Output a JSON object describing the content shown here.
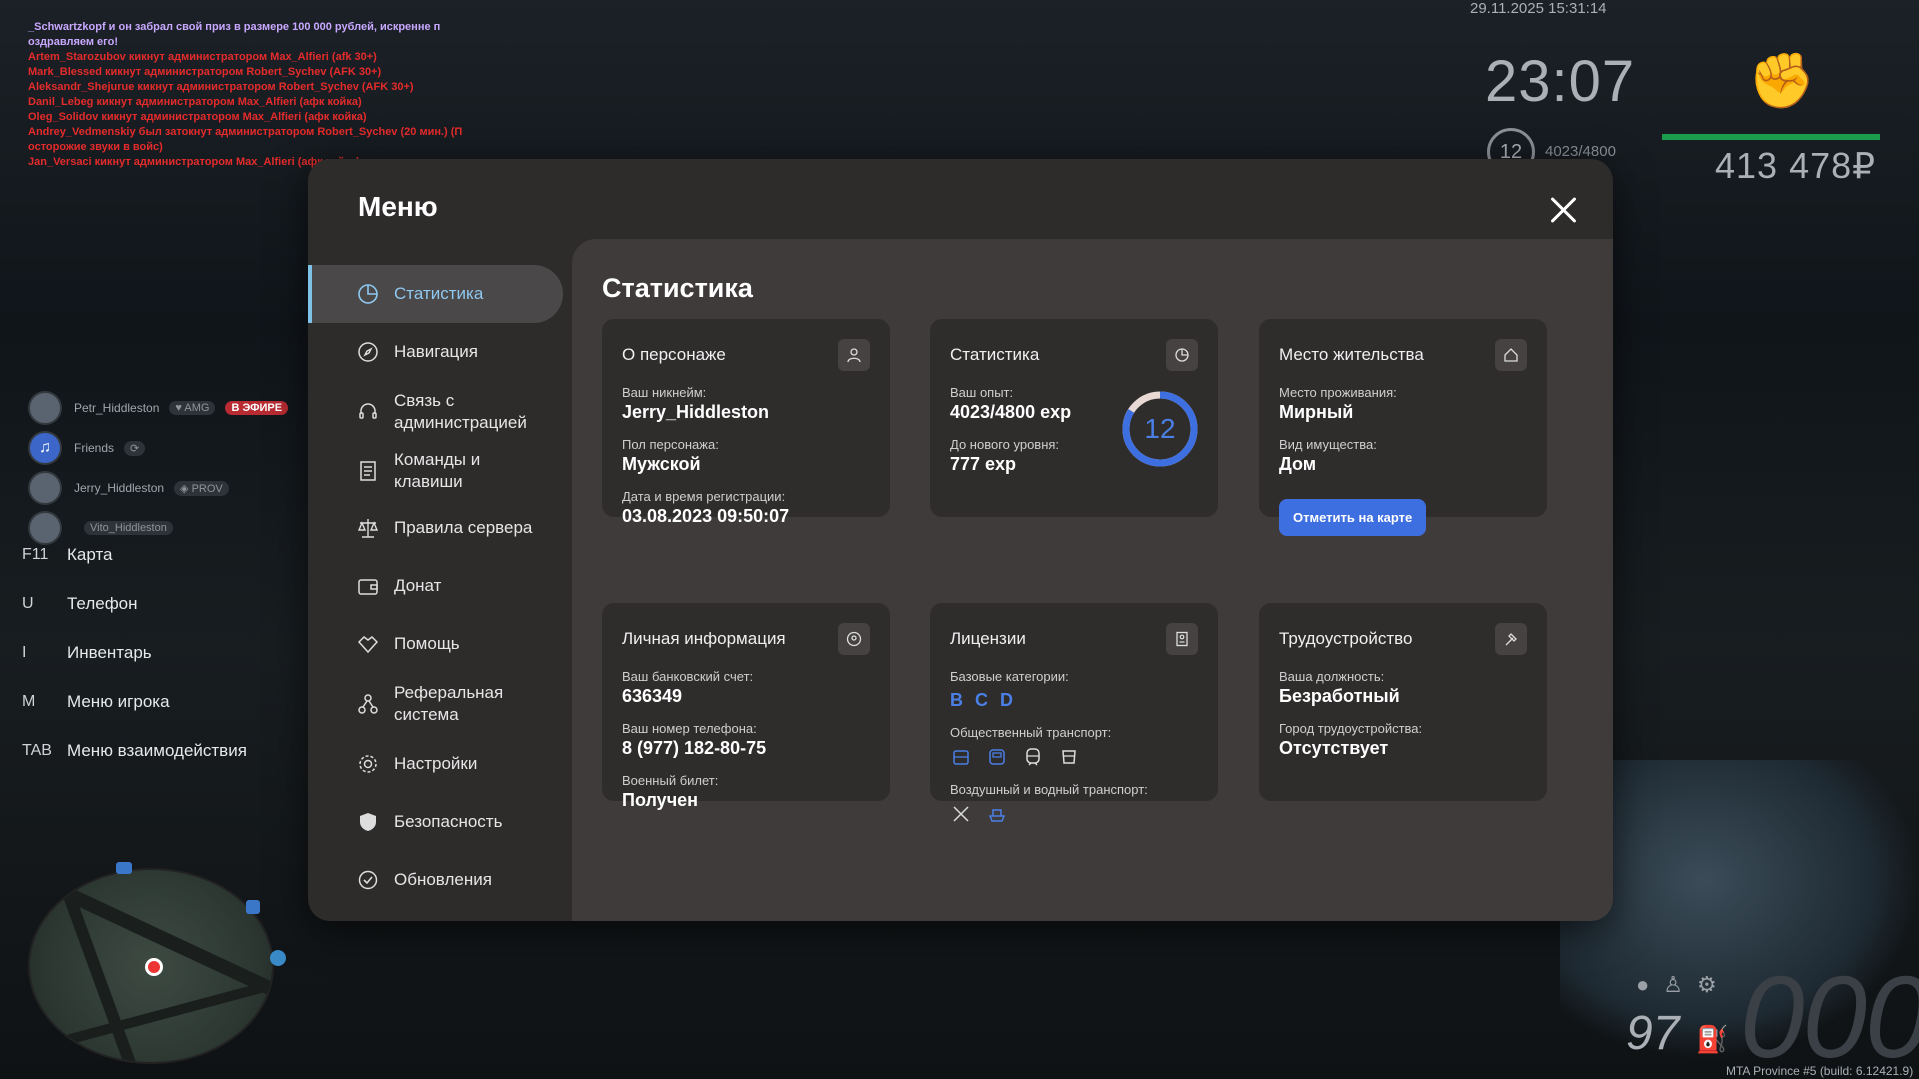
{
  "chat": [
    "_Schwartzkopf и он забрал свой приз в размере 100 000 рублей, искренне п",
    "оздравляем его!",
    "Artem_Starozubov кикнут администратором Max_Alfieri (afk 30+)",
    "Mark_Blessed кикнут администратором Robert_Sychev (AFK 30+)",
    "Aleksandr_Shejurue кикнут администратором Robert_Sychev (AFK 30+)",
    "Danil_Lebeg кикнут администратором Max_Alfieri (афк койка)",
    "Oleg_Solidov кикнут администратором Max_Alfieri (афк койка)",
    "Andrey_Vedmenskiy был затокнут администратором Robert_Sychev (20 мин.) (П",
    "осторожие звуки в войс)",
    "Jan_Versaci кикнут администратором Max_Alfieri (афк койка)"
  ],
  "hud": {
    "datetime": "29.11.2025 15:31:14",
    "clock": "23:07",
    "level": "12",
    "exp": "4023/4800",
    "money": "413 478₽",
    "health_fraction": 1.0,
    "fuel": "97",
    "speed": "000",
    "build": "MTA Province #5 (build: 6.12421.9)"
  },
  "social": [
    {
      "name": "Petr_Hiddleston",
      "badge": "AMG",
      "live": "В ЭФИРЕ"
    },
    {
      "name": "Friends",
      "badge": "",
      "live": ""
    },
    {
      "name": "Jerry_Hiddleston",
      "badge": "PROV",
      "live": ""
    },
    {
      "name": "Vito_Hiddleston",
      "badge": "",
      "live": ""
    }
  ],
  "keybinds": [
    {
      "key": "F11",
      "label": "Карта"
    },
    {
      "key": "U",
      "label": "Телефон"
    },
    {
      "key": "I",
      "label": "Инвентарь"
    },
    {
      "key": "M",
      "label": "Меню игрока"
    },
    {
      "key": "TAB",
      "label": "Меню взаимодействия"
    }
  ],
  "menu": {
    "title": "Меню",
    "nav": [
      {
        "label": "Статистика",
        "icon": "pie-chart-icon",
        "active": true
      },
      {
        "label": "Навигация",
        "icon": "compass-icon"
      },
      {
        "label": "Связь с администрацией",
        "icon": "headset-icon"
      },
      {
        "label": "Команды и клавиши",
        "icon": "document-icon"
      },
      {
        "label": "Правила сервера",
        "icon": "scales-icon"
      },
      {
        "label": "Донат",
        "icon": "wallet-icon"
      },
      {
        "label": "Помощь",
        "icon": "handshake-icon"
      },
      {
        "label": "Реферальная система",
        "icon": "network-icon"
      },
      {
        "label": "Настройки",
        "icon": "gear-icon"
      },
      {
        "label": "Безопасность",
        "icon": "shield-icon"
      },
      {
        "label": "Обновления",
        "icon": "refresh-check-icon"
      }
    ],
    "content_title": "Статистика",
    "character": {
      "title": "О персонаже",
      "nick_label": "Ваш никнейм:",
      "nick": "Jerry_Hiddleston",
      "gender_label": "Пол персонажа:",
      "gender": "Мужской",
      "reg_label": "Дата и время регистрации:",
      "reg": "03.08.2023 09:50:07"
    },
    "stats": {
      "title": "Статистика",
      "exp_label": "Ваш опыт:",
      "exp": "4023/4800 exp",
      "next_label": "До нового уровня:",
      "next": "777 exp",
      "level": "12",
      "progress": 0.838
    },
    "residence": {
      "title": "Место жительства",
      "place_label": "Место проживания:",
      "place": "Мирный",
      "type_label": "Вид имущества:",
      "type": "Дом",
      "button": "Отметить на карте"
    },
    "personal": {
      "title": "Личная информация",
      "bank_label": "Ваш банковский счет:",
      "bank": "636349",
      "phone_label": "Ваш номер телефона:",
      "phone": "8 (977) 182-80-75",
      "military_label": "Военный билет:",
      "military": "Получен"
    },
    "licenses": {
      "title": "Лицензии",
      "base_label": "Базовые категории:",
      "categories": [
        "B",
        "C",
        "D"
      ],
      "public_label": "Общественный транспорт:",
      "air_label": "Воздушный и водный транспорт:"
    },
    "job": {
      "title": "Трудоустройство",
      "position_label": "Ваша должность:",
      "position": "Безработный",
      "city_label": "Город трудоустройства:",
      "city": "Отсутствует"
    }
  },
  "colors": {
    "accent": "#3e6fe0",
    "active_nav": "#8fc8f0",
    "chat_red": "#e52b2b"
  }
}
